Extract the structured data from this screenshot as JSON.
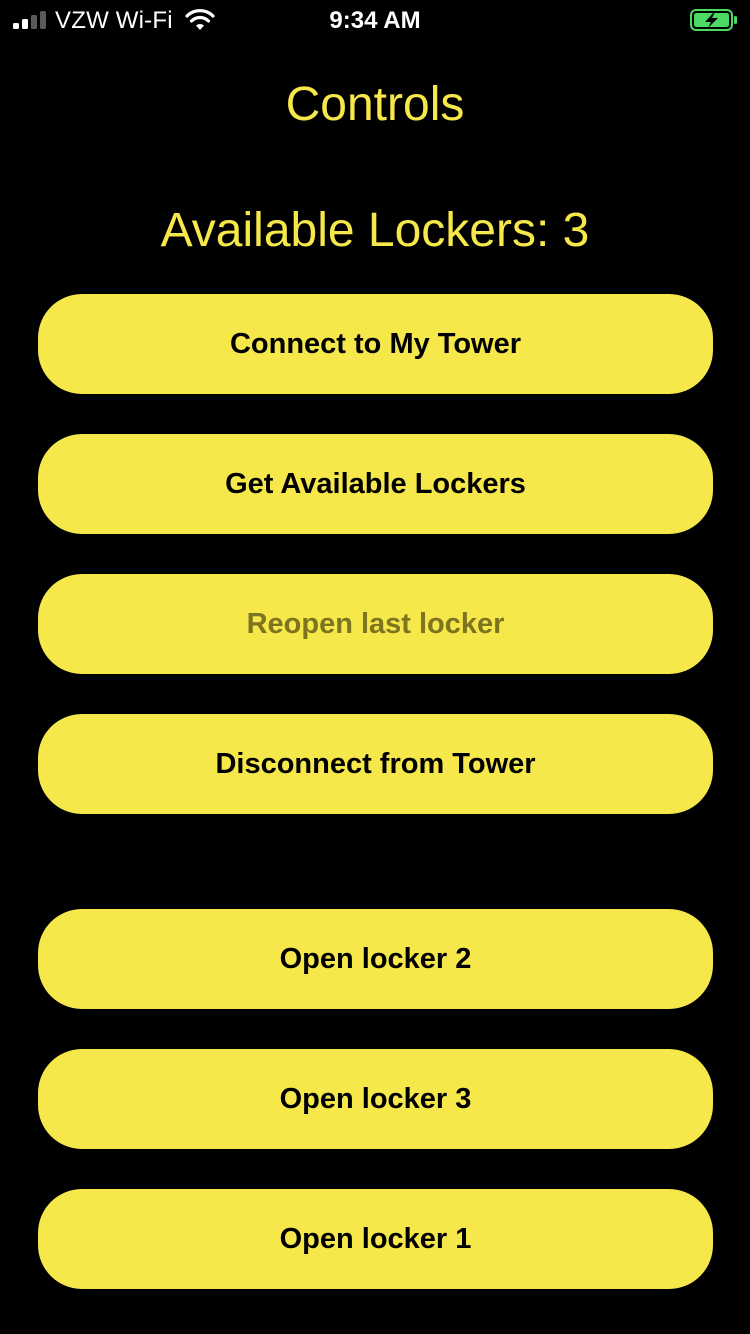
{
  "status_bar": {
    "carrier": "VZW Wi-Fi",
    "time": "9:34 AM",
    "signal_icon": "cellular-signal-icon",
    "wifi_icon": "wifi-icon",
    "battery_icon": "battery-charging-icon"
  },
  "header": {
    "title": "Controls"
  },
  "lockers": {
    "available_label": "Available Lockers: 3"
  },
  "controls": {
    "connect_label": "Connect to My Tower",
    "get_available_label": "Get Available Lockers",
    "reopen_label": "Reopen last locker",
    "disconnect_label": "Disconnect from Tower"
  },
  "locker_buttons": [
    {
      "label": "Open locker 2"
    },
    {
      "label": "Open locker 3"
    },
    {
      "label": "Open locker 1"
    }
  ],
  "colors": {
    "background": "#000000",
    "accent": "#f6e84a",
    "button_text": "#000000",
    "button_text_disabled": "#7d7420",
    "battery_charging": "#4cd964"
  }
}
